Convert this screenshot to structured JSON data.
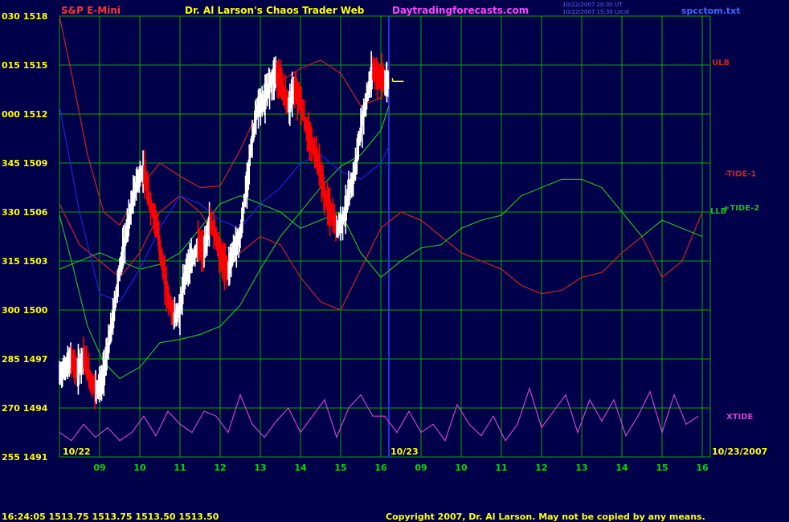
{
  "header": {
    "instrument": "S&P E-Mini",
    "title": "Dr. Al Larson's Chaos Trader Web",
    "site": "Daytradingforecasts.com",
    "stamp1": "10/22/2007 20:30 UT",
    "stamp2": "10/22/2007 15:30 Local",
    "file": "spcctom.txt"
  },
  "footer": {
    "quote": "16:24:05  1513.75  1513.75  1513.50  1513.50",
    "copyright": "Copyright 2007, Dr. Al Larson. May not be copied by any means."
  },
  "colors": {
    "background": "#00004a",
    "grid": "#00aa00",
    "up_bar": "#ffffff",
    "down_bar": "#ff0000",
    "ulb": "#cc2222",
    "llb": "#22bb22",
    "xtide": "#cc44cc",
    "ma": "#2222dd",
    "signal": "#ffff00"
  },
  "chart_data": {
    "type": "line",
    "y_axis_left": [
      "030 1518",
      "015 1515",
      "000 1512",
      "345 1509",
      "330 1506",
      "315 1503",
      "300 1500",
      "285 1497",
      "270 1494",
      "255 1491"
    ],
    "y_range": [
      1491,
      1518
    ],
    "x_ticks_day1": [
      "09",
      "10",
      "11",
      "12",
      "13",
      "14",
      "15",
      "16"
    ],
    "x_ticks_day2": [
      "09",
      "10",
      "11",
      "12",
      "13",
      "14",
      "15",
      "16"
    ],
    "date_labels": [
      "10/22",
      "10/23",
      "10/23/2007"
    ],
    "line_labels": [
      "ULB",
      "-TIDE-1",
      "+TIDE-2",
      "LLB",
      "XTIDE"
    ],
    "price_path": {
      "x_hours": [
        8.0,
        8.15,
        8.3,
        8.45,
        8.6,
        8.75,
        8.9,
        9.05,
        9.2,
        9.35,
        9.5,
        9.65,
        9.8,
        9.95,
        10.1,
        10.25,
        10.4,
        10.55,
        10.7,
        10.85,
        11.0,
        11.15,
        11.3,
        11.45,
        11.6,
        11.75,
        11.9,
        12.05,
        12.2,
        12.35,
        12.5,
        12.65,
        12.8,
        12.95,
        13.1,
        13.25,
        13.4,
        13.55,
        13.7,
        13.85,
        14.0,
        14.15,
        14.3,
        14.45,
        14.6,
        14.75,
        14.9,
        15.05,
        15.2,
        15.35,
        15.5,
        15.65,
        15.8,
        15.95,
        16.1,
        16.2
      ],
      "close": [
        1496.0,
        1496.5,
        1497.0,
        1496.2,
        1497.3,
        1495.8,
        1495.2,
        1495.5,
        1497.5,
        1499.8,
        1502.5,
        1504.5,
        1506.5,
        1508.0,
        1508.5,
        1506.5,
        1505.5,
        1503.0,
        1500.8,
        1499.5,
        1500.0,
        1502.5,
        1503.0,
        1504.0,
        1503.5,
        1505.5,
        1504.5,
        1503.0,
        1502.5,
        1503.8,
        1504.5,
        1507.5,
        1510.5,
        1512.5,
        1512.8,
        1514.0,
        1514.5,
        1513.5,
        1512.5,
        1513.5,
        1512.8,
        1511.0,
        1510.0,
        1509.0,
        1507.0,
        1506.0,
        1505.0,
        1505.5,
        1507.0,
        1508.5,
        1511.0,
        1513.0,
        1514.8,
        1514.2,
        1514.0,
        1514.0
      ]
    },
    "series": [
      {
        "name": "ULB",
        "x_hours": [
          8.0,
          8.3,
          8.7,
          9.1,
          9.5,
          10.0,
          10.5,
          11.0,
          11.5,
          12.0,
          12.5,
          13.0,
          13.5,
          14.0,
          14.5,
          15.0,
          15.5,
          16.0,
          16.2
        ],
        "y": [
          1518.0,
          1514.5,
          1509.5,
          1506.0,
          1505.2,
          1507.5,
          1509.0,
          1508.2,
          1507.5,
          1507.6,
          1509.8,
          1512.5,
          1514.0,
          1514.8,
          1515.3,
          1514.5,
          1512.5,
          1513.0,
          1514.8
        ]
      },
      {
        "name": "LLB",
        "x_hours": [
          8.0,
          8.3,
          8.7,
          9.1,
          9.5,
          10.0,
          10.5,
          11.0,
          11.5,
          12.0,
          12.5,
          13.0,
          13.5,
          14.0,
          14.5,
          15.0,
          15.5,
          16.0,
          16.2
        ],
        "y": [
          1505.8,
          1503.0,
          1499.0,
          1496.8,
          1495.8,
          1496.5,
          1498.0,
          1498.2,
          1498.5,
          1499.0,
          1500.3,
          1502.5,
          1504.5,
          1506.0,
          1507.5,
          1508.8,
          1509.5,
          1511.0,
          1512.5
        ]
      },
      {
        "name": "-TIDE-1",
        "x_hours": [
          8.0,
          8.5,
          9.0,
          9.5,
          10.0,
          10.5,
          11.0,
          11.5,
          12.0,
          12.5,
          13.0,
          13.5,
          14.0,
          14.5,
          15.0,
          15.5,
          16.0,
          16.5,
          17.0,
          17.5,
          18.0,
          18.5,
          19.0,
          19.5,
          20.0,
          20.5,
          21.0,
          21.5,
          22.0,
          22.5,
          23.0,
          23.5,
          24.0
        ],
        "y": [
          1506.5,
          1504.0,
          1503.0,
          1502.0,
          1503.5,
          1506.0,
          1507.0,
          1506.0,
          1504.0,
          1503.5,
          1504.5,
          1504.0,
          1502.0,
          1500.5,
          1500.0,
          1502.5,
          1505.0,
          1506.0,
          1505.5,
          1504.5,
          1503.5,
          1503.0,
          1502.5,
          1501.5,
          1501.0,
          1501.2,
          1502.0,
          1502.3,
          1503.5,
          1504.5,
          1502.0,
          1503.0,
          1506.0
        ]
      },
      {
        "name": "+TIDE-2",
        "x_hours": [
          8.0,
          8.5,
          9.0,
          9.5,
          10.0,
          10.5,
          11.0,
          11.5,
          12.0,
          12.5,
          13.0,
          13.5,
          14.0,
          14.5,
          15.0,
          15.5,
          16.0,
          16.5,
          17.0,
          17.5,
          18.0,
          18.5,
          19.0,
          19.5,
          20.0,
          20.5,
          21.0,
          21.5,
          22.0,
          22.5,
          23.0,
          23.5,
          24.0
        ],
        "y": [
          1502.5,
          1503.0,
          1503.5,
          1503.0,
          1502.5,
          1502.8,
          1503.5,
          1505.0,
          1506.5,
          1507.0,
          1506.5,
          1506.0,
          1505.0,
          1505.5,
          1506.0,
          1503.5,
          1502.0,
          1503.0,
          1503.8,
          1504.0,
          1505.0,
          1505.5,
          1505.8,
          1507.0,
          1507.5,
          1508.0,
          1508.0,
          1507.5,
          1506.0,
          1504.5,
          1505.5,
          1505.0,
          1504.5
        ]
      },
      {
        "name": "XTIDE",
        "x_hours": [
          8.0,
          8.3,
          8.6,
          8.9,
          9.2,
          9.5,
          9.8,
          10.1,
          10.4,
          10.7,
          11.0,
          11.3,
          11.6,
          11.9,
          12.2,
          12.5,
          12.8,
          13.1,
          13.4,
          13.7,
          14.0,
          14.3,
          14.6,
          14.9,
          15.2,
          15.5,
          15.8,
          16.1,
          16.4,
          16.7,
          17.0,
          17.3,
          17.6,
          17.9,
          18.2,
          18.5,
          18.8,
          19.1,
          19.4,
          19.7,
          20.0,
          20.3,
          20.6,
          20.9,
          21.2,
          21.5,
          21.8,
          22.1,
          22.4,
          22.7,
          23.0,
          23.3,
          23.6,
          23.9
        ],
        "y": [
          1492.5,
          1492.0,
          1493.0,
          1492.2,
          1492.8,
          1492.0,
          1492.5,
          1493.5,
          1492.3,
          1493.8,
          1493.0,
          1492.5,
          1493.8,
          1493.5,
          1492.5,
          1494.8,
          1493.0,
          1492.2,
          1493.2,
          1494.0,
          1492.5,
          1493.5,
          1494.5,
          1492.2,
          1494.0,
          1494.8,
          1493.5,
          1493.5,
          1492.5,
          1493.8,
          1492.5,
          1493.0,
          1492.0,
          1494.2,
          1493.0,
          1492.3,
          1493.5,
          1492.0,
          1493.0,
          1495.2,
          1492.8,
          1493.8,
          1494.8,
          1492.5,
          1494.5,
          1493.2,
          1494.5,
          1492.3,
          1493.5,
          1495.0,
          1492.5,
          1494.8,
          1493.0,
          1493.5
        ]
      },
      {
        "name": "",
        "x_hours": [
          8.0,
          8.5,
          9.0,
          9.5,
          10.0,
          10.5,
          11.0,
          11.5,
          12.0,
          12.5,
          13.0,
          13.5,
          14.0,
          14.5,
          15.0,
          15.5,
          16.0,
          16.2
        ],
        "y": [
          1512.5,
          1506.0,
          1501.0,
          1500.5,
          1502.5,
          1505.0,
          1507.0,
          1506.5,
          1505.5,
          1505.0,
          1506.5,
          1507.5,
          1509.0,
          1509.5,
          1508.5,
          1508.0,
          1509.0,
          1510.0
        ]
      }
    ]
  }
}
